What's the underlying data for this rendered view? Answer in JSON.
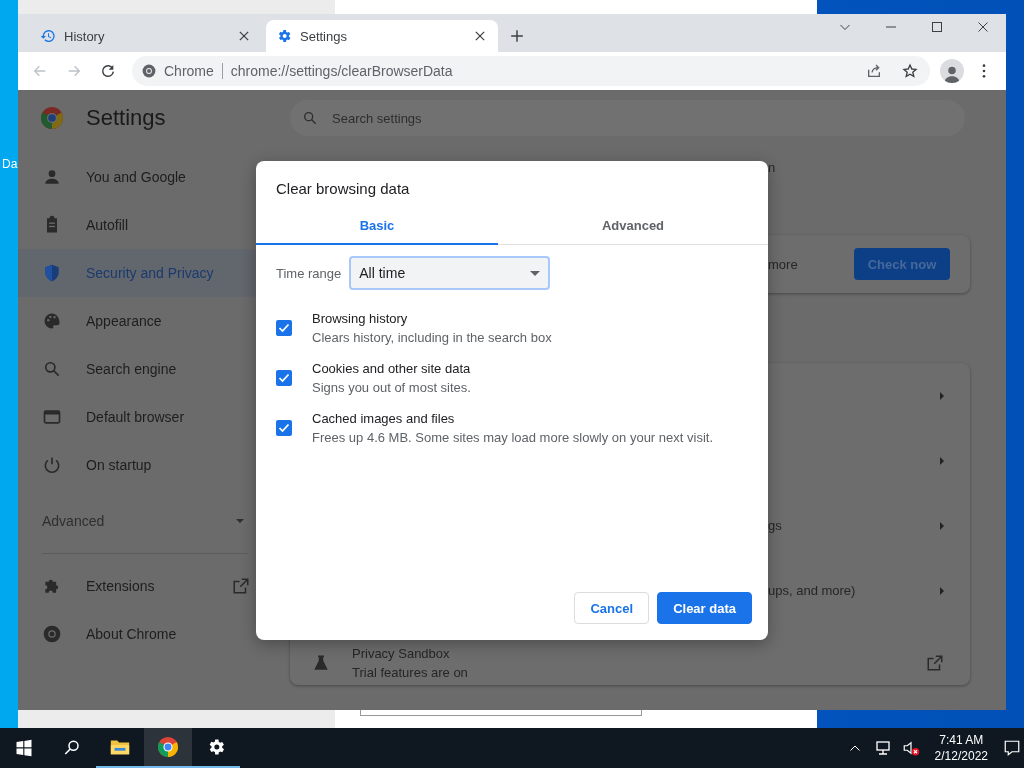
{
  "desktop": {
    "icon_label": "Da"
  },
  "browser": {
    "tabs": [
      {
        "title": "History",
        "selected": false
      },
      {
        "title": "Settings",
        "selected": true
      }
    ],
    "address_bar": {
      "site_chip": "Chrome",
      "url": "chrome://settings/clearBrowserData"
    }
  },
  "settings": {
    "title": "Settings",
    "search": {
      "placeholder": "Search settings"
    },
    "sidebar": {
      "items": [
        {
          "label": "You and Google",
          "selected": false
        },
        {
          "label": "Autofill",
          "selected": false
        },
        {
          "label": "Security and Privacy",
          "selected": true
        },
        {
          "label": "Appearance",
          "selected": false
        },
        {
          "label": "Search engine",
          "selected": false
        },
        {
          "label": "Default browser",
          "selected": false
        },
        {
          "label": "On startup",
          "selected": false
        }
      ],
      "advanced": {
        "label": "Advanced",
        "expanded": false
      },
      "footer_items": [
        {
          "label": "Extensions"
        },
        {
          "label": "About Chrome"
        }
      ]
    },
    "safety_check": {
      "heading_fragment": "n",
      "text_fragment": "more",
      "button": "Check now"
    },
    "privacy_card": {
      "row_fragments": [
        "gs",
        "ups, and more)"
      ],
      "sandbox": {
        "title": "Privacy Sandbox",
        "subtitle": "Trial features are on"
      }
    }
  },
  "dialog": {
    "title": "Clear browsing data",
    "tabs": [
      {
        "label": "Basic",
        "selected": true
      },
      {
        "label": "Advanced",
        "selected": false
      }
    ],
    "time_range": {
      "label": "Time range",
      "value": "All time"
    },
    "options": [
      {
        "label": "Browsing history",
        "description": "Clears history, including in the search box",
        "checked": true
      },
      {
        "label": "Cookies and other site data",
        "description": "Signs you out of most sites.",
        "checked": true
      },
      {
        "label": "Cached images and files",
        "description": "Frees up 4.6 MB. Some sites may load more slowly on your next visit.",
        "checked": true
      }
    ],
    "buttons": [
      {
        "label": "Cancel",
        "kind": "secondary"
      },
      {
        "label": "Clear data",
        "kind": "primary"
      }
    ]
  },
  "taskbar": {
    "apps": [
      {
        "running": true,
        "selected": false
      },
      {
        "running": true,
        "selected": true
      },
      {
        "running": true,
        "selected": false
      }
    ],
    "time": "7:41 AM",
    "date": "2/12/2022"
  }
}
